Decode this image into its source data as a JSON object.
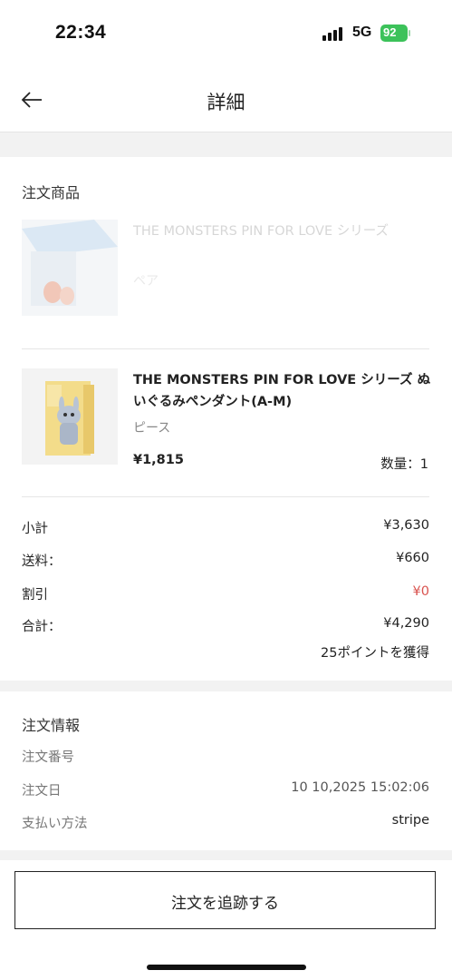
{
  "status_bar": {
    "time": "22:34",
    "network": "5G",
    "battery": "92"
  },
  "header": {
    "title": "詳細"
  },
  "order_items": {
    "section_title": "注文商品",
    "items": [
      {
        "name": "THE MONSTERS PIN FOR LOVE シリーズ",
        "variant": "ペア",
        "price": "",
        "quantity": "",
        "faded": true
      },
      {
        "name": "THE MONSTERS PIN FOR LOVE シリーズ ぬいぐるみペンダント(A-M)",
        "variant": "ピース",
        "price": "¥1,815",
        "quantity": "数量：1",
        "faded": false
      }
    ]
  },
  "summary": {
    "subtotal_label": "小計",
    "subtotal_value": "¥3,630",
    "shipping_label": "送料：",
    "shipping_value": "¥660",
    "discount_label": "割引",
    "discount_value": "¥0",
    "total_label": "合計：",
    "total_value": "¥4,290",
    "points": "25ポイントを獲得"
  },
  "order_info": {
    "section_title": "注文情報",
    "order_number_label": "注文番号",
    "order_number_value": "",
    "order_date_label": "注文日",
    "order_date_value": "10 10,2025 15:02:06",
    "payment_label": "支払い方法",
    "payment_value": "stripe"
  },
  "actions": {
    "track_label": "注文を追跡する"
  },
  "colors": {
    "discount": "#d9534f",
    "battery": "#3cc25a",
    "accent": "#222222"
  },
  "icons": {
    "back": "arrow-left-icon",
    "signal": "signal-bars-icon",
    "battery": "battery-icon"
  }
}
